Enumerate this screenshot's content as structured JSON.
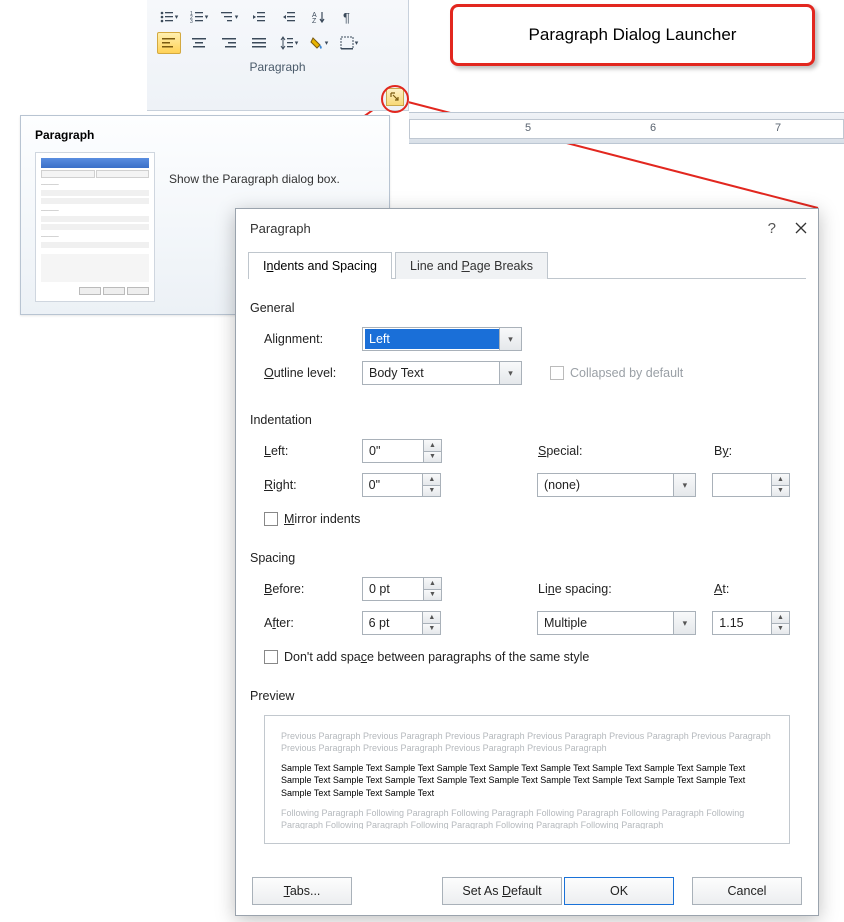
{
  "callout": {
    "text": "Paragraph Dialog Launcher"
  },
  "ribbon": {
    "groupLabel": "Paragraph"
  },
  "ruler": {
    "n1": "5",
    "n2": "6",
    "n3": "7"
  },
  "tooltip": {
    "title": "Paragraph",
    "desc": "Show the Paragraph dialog box."
  },
  "dialog": {
    "title": "Paragraph",
    "tabs": {
      "t1_pre": "I",
      "t1_u": "n",
      "t1_post": "dents and Spacing",
      "t2_pre": "Line and ",
      "t2_u": "P",
      "t2_post": "age Breaks"
    },
    "general": {
      "heading": "General",
      "alignment_pre": "Ali",
      "alignment_u": "g",
      "alignment_post": "nment:",
      "alignment_val": "Left",
      "outline_u": "O",
      "outline_post": "utline level:",
      "outline_val": "Body Text",
      "collapsed": "Collapsed by default"
    },
    "indent": {
      "heading": "Indentation",
      "left_u": "L",
      "left_post": "eft:",
      "left_val": "0\"",
      "right_u": "R",
      "right_post": "ight:",
      "right_val": "0\"",
      "special_u": "S",
      "special_post": "pecial:",
      "special_val": "(none)",
      "by_pre": "B",
      "by_u": "y",
      "by_post": ":",
      "by_val": "",
      "mirror_u": "M",
      "mirror_post": "irror indents"
    },
    "spacing": {
      "heading": "Spacing",
      "before_u": "B",
      "before_post": "efore:",
      "before_val": "0 pt",
      "after_pre": "A",
      "after_u": "f",
      "after_post": "ter:",
      "after_val": "6 pt",
      "line_pre": "Li",
      "line_u": "n",
      "line_post": "e spacing:",
      "line_val": "Multiple",
      "at_u": "A",
      "at_post": "t:",
      "at_val": "1.15",
      "dont_pre": "Don't add spa",
      "dont_u": "c",
      "dont_post": "e between paragraphs of the same style"
    },
    "preview": {
      "heading": "Preview",
      "prev": "Previous Paragraph Previous Paragraph Previous Paragraph Previous Paragraph Previous Paragraph Previous Paragraph Previous Paragraph Previous Paragraph Previous Paragraph Previous Paragraph",
      "main": "Sample Text Sample Text Sample Text Sample Text Sample Text Sample Text Sample Text Sample Text Sample Text Sample Text Sample Text Sample Text Sample Text Sample Text Sample Text Sample Text Sample Text Sample Text Sample Text Sample Text Sample Text",
      "next": "Following Paragraph Following Paragraph Following Paragraph Following Paragraph Following Paragraph Following Paragraph Following Paragraph Following Paragraph Following Paragraph Following Paragraph"
    },
    "buttons": {
      "tabs_u": "T",
      "tabs_post": "abs...",
      "default_pre": "Set As ",
      "default_u": "D",
      "default_post": "efault",
      "ok": "OK",
      "cancel": "Cancel"
    }
  }
}
